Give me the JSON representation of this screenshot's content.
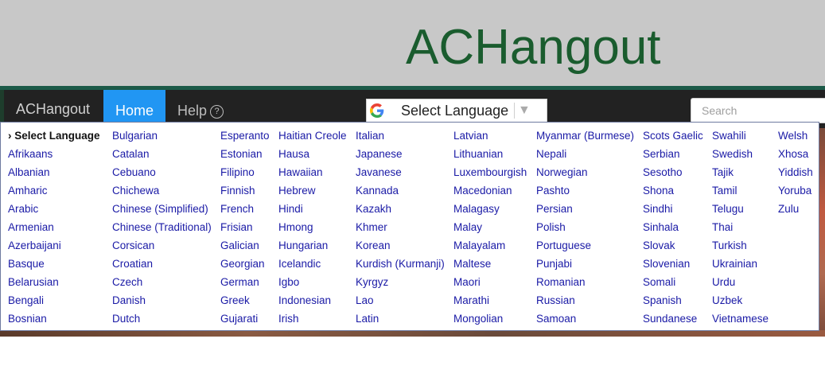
{
  "site": {
    "title": "ACHangout"
  },
  "nav": {
    "brand": "ACHangout",
    "home": "Home",
    "help": "Help",
    "help_icon": "?"
  },
  "translate": {
    "label": "Select Language",
    "arrow": "▼"
  },
  "search": {
    "placeholder": "Search"
  },
  "colors": {
    "title_green": "#1a5c2e",
    "nav_bg": "#222222",
    "home_active": "#2196f3",
    "link_blue": "#1a1aa6"
  },
  "languages": [
    [
      "› Select Language",
      "Afrikaans",
      "Albanian",
      "Amharic",
      "Arabic",
      "Armenian",
      "Azerbaijani",
      "Basque",
      "Belarusian",
      "Bengali",
      "Bosnian"
    ],
    [
      "Bulgarian",
      "Catalan",
      "Cebuano",
      "Chichewa",
      "Chinese (Simplified)",
      "Chinese (Traditional)",
      "Corsican",
      "Croatian",
      "Czech",
      "Danish",
      "Dutch"
    ],
    [
      "Esperanto",
      "Estonian",
      "Filipino",
      "Finnish",
      "French",
      "Frisian",
      "Galician",
      "Georgian",
      "German",
      "Greek",
      "Gujarati"
    ],
    [
      "Haitian Creole",
      "Hausa",
      "Hawaiian",
      "Hebrew",
      "Hindi",
      "Hmong",
      "Hungarian",
      "Icelandic",
      "Igbo",
      "Indonesian",
      "Irish"
    ],
    [
      "Italian",
      "Japanese",
      "Javanese",
      "Kannada",
      "Kazakh",
      "Khmer",
      "Korean",
      "Kurdish (Kurmanji)",
      "Kyrgyz",
      "Lao",
      "Latin"
    ],
    [
      "Latvian",
      "Lithuanian",
      "Luxembourgish",
      "Macedonian",
      "Malagasy",
      "Malay",
      "Malayalam",
      "Maltese",
      "Maori",
      "Marathi",
      "Mongolian"
    ],
    [
      "Myanmar (Burmese)",
      "Nepali",
      "Norwegian",
      "Pashto",
      "Persian",
      "Polish",
      "Portuguese",
      "Punjabi",
      "Romanian",
      "Russian",
      "Samoan"
    ],
    [
      "Scots Gaelic",
      "Serbian",
      "Sesotho",
      "Shona",
      "Sindhi",
      "Sinhala",
      "Slovak",
      "Slovenian",
      "Somali",
      "Spanish",
      "Sundanese"
    ],
    [
      "Swahili",
      "Swedish",
      "Tajik",
      "Tamil",
      "Telugu",
      "Thai",
      "Turkish",
      "Ukrainian",
      "Urdu",
      "Uzbek",
      "Vietnamese"
    ],
    [
      "Welsh",
      "Xhosa",
      "Yiddish",
      "Yoruba",
      "Zulu"
    ]
  ]
}
